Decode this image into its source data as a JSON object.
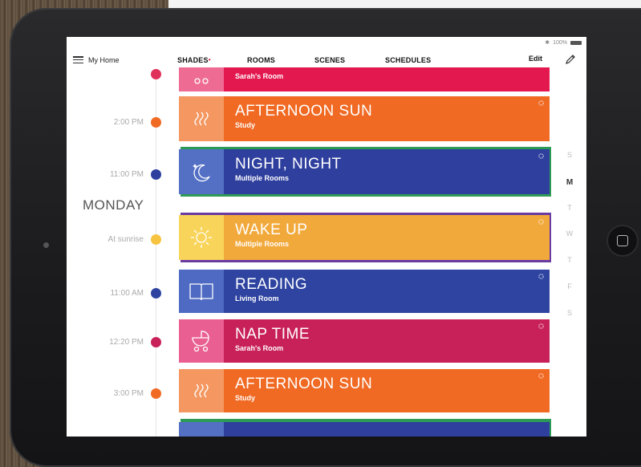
{
  "status": {
    "battery": "100%"
  },
  "header": {
    "home": "My Home",
    "tabs": [
      {
        "label": "SHADES",
        "dot": "•"
      },
      {
        "label": "ROOMS"
      },
      {
        "label": "SCENES"
      },
      {
        "label": "SCHEDULES"
      }
    ],
    "edit": "Edit"
  },
  "day_label": "MONDAY",
  "events": [
    {
      "time": "",
      "title": "",
      "subtitle": "Sarah's Room",
      "color": "#e3184f",
      "icon_color": "#ee6b93",
      "dot": "#e0315a"
    },
    {
      "time": "2:00 PM",
      "title": "AFTERNOON SUN",
      "subtitle": "Study",
      "color": "#f06a24",
      "icon_color": "#f49760",
      "dot": "#f06a24"
    },
    {
      "time": "11:00 PM",
      "title": "NIGHT, NIGHT",
      "subtitle": "Multiple Rooms",
      "color": "#2f3f9e",
      "icon_color": "#5470c5",
      "dot": "#2f3f9e"
    },
    {
      "time": "At sunrise",
      "title": "WAKE UP",
      "subtitle": "Multiple Rooms",
      "color": "#f2a93b",
      "icon_color": "#f9d45a",
      "dot": "#f7c442"
    },
    {
      "time": "11:00 AM",
      "title": "READING",
      "subtitle": "Living Room",
      "color": "#2e44a0",
      "icon_color": "#4e6ac2",
      "dot": "#2e44a0"
    },
    {
      "time": "12:20 PM",
      "title": "NAP TIME",
      "subtitle": "Sarah's Room",
      "color": "#c8215a",
      "icon_color": "#ea5f92",
      "dot": "#c8215a"
    },
    {
      "time": "3:00 PM",
      "title": "AFTERNOON SUN",
      "subtitle": "Study",
      "color": "#f06a24",
      "icon_color": "#f49760",
      "dot": "#f06a24"
    }
  ],
  "weekdays": [
    "S",
    "M",
    "T",
    "W",
    "T",
    "F",
    "S"
  ]
}
